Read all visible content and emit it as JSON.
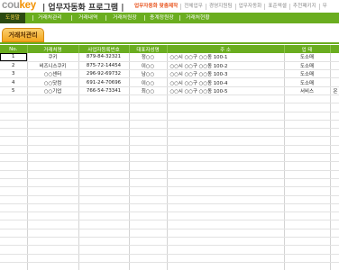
{
  "brand": {
    "logo_main": "cou",
    "logo_accent": "key",
    "app_title": "| 업무자동화 프로그램 |"
  },
  "topnav": [
    "업무자동화 맞춤제작",
    "전체업무",
    "경영지원팀",
    "업무자동화",
    "표준엑셀",
    "추천패키지",
    "무"
  ],
  "menu": [
    "도움말",
    "거래처관리",
    "거래내역",
    "거래처원장",
    "총계정원장",
    "거래처현황"
  ],
  "section_title": "거래처관리",
  "table": {
    "headers": [
      "No.",
      "거래처명",
      "사업자등록번호",
      "대표자성명",
      "주 소",
      "업 태",
      ""
    ],
    "rows": [
      [
        "1",
        "쿠키",
        "879-84-32321",
        "정○○",
        "○○시 ○○구 ○○동 100-1",
        "도소매",
        ""
      ],
      [
        "2",
        "비즈니스쿠키",
        "875-72-14454",
        "이○○",
        "○○시 ○○구 ○○동 100-2",
        "도소매",
        ""
      ],
      [
        "3",
        "○○센터",
        "296-92-69732",
        "남○○",
        "○○시 ○○구 ○○동 100-3",
        "도소매",
        ""
      ],
      [
        "4",
        "○○닷컴",
        "691-24-70696",
        "이○○",
        "○○시 ○○구 ○○동 100-4",
        "도소매",
        ""
      ],
      [
        "5",
        "○○기업",
        "766-54-73341",
        "최○○",
        "○○시 ○○구 ○○동 100-5",
        "서비스",
        "온"
      ]
    ],
    "empty_rows": 22
  },
  "colors": {
    "menu_green": "#6aad1f",
    "active_menu": "#2c4a12",
    "tab_orange": "#f2a51c"
  }
}
